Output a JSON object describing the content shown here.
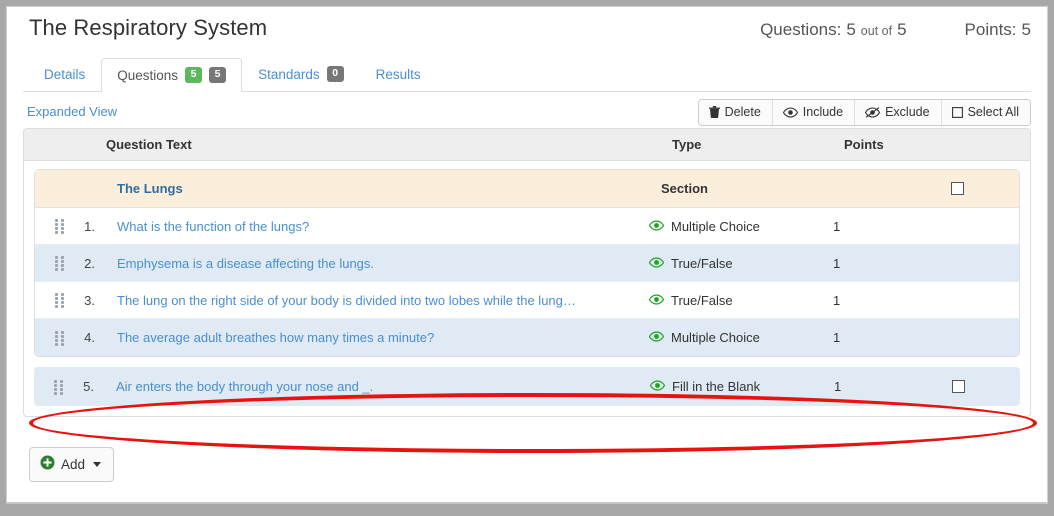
{
  "header": {
    "title": "The Respiratory System",
    "stats": [
      {
        "label": "Questions:",
        "value": "5",
        "middle": "out of",
        "total": "5"
      },
      {
        "label": "Points:",
        "value": "5",
        "middle": "",
        "total": ""
      }
    ]
  },
  "tabs": [
    {
      "label": "Details",
      "badges": [],
      "active": false
    },
    {
      "label": "Questions",
      "badges": [
        {
          "text": "5",
          "color": "green"
        },
        {
          "text": "5",
          "color": "gray"
        }
      ],
      "active": true
    },
    {
      "label": "Standards",
      "badges": [
        {
          "text": "0",
          "color": "gray"
        }
      ],
      "active": false
    },
    {
      "label": "Results",
      "badges": [],
      "active": false
    }
  ],
  "subbar": {
    "expanded_view_label": "Expanded View",
    "buttons": [
      {
        "label": "Delete",
        "icon": "trash-icon"
      },
      {
        "label": "Include",
        "icon": "eye-icon"
      },
      {
        "label": "Exclude",
        "icon": "eye-slash-icon"
      },
      {
        "label": "Select All",
        "icon": "checkbox-icon"
      }
    ]
  },
  "table": {
    "columns": {
      "question_text": "Question Text",
      "type": "Type",
      "points": "Points"
    },
    "section": {
      "title": "The Lungs",
      "type_label": "Section",
      "checkbox_checked": false
    },
    "rows": [
      {
        "number": "1.",
        "text": "What is the function of the lungs?",
        "type": "Multiple Choice",
        "points": "1",
        "visibility_icon": "eye-icon",
        "has_checkbox": false,
        "alt": false
      },
      {
        "number": "2.",
        "text": "Emphysema is a disease affecting the lungs.",
        "type": "True/False",
        "points": "1",
        "visibility_icon": "eye-icon",
        "has_checkbox": false,
        "alt": true
      },
      {
        "number": "3.",
        "text": "The lung on the right side of your body is divided into two lobes while the lung…",
        "type": "True/False",
        "points": "1",
        "visibility_icon": "eye-icon",
        "has_checkbox": false,
        "alt": false
      },
      {
        "number": "4.",
        "text": "The average adult breathes how many times a minute?",
        "type": "Multiple Choice",
        "points": "1",
        "visibility_icon": "eye-icon",
        "has_checkbox": false,
        "alt": true
      }
    ],
    "standalone_row": {
      "number": "5.",
      "text": "Air enters the body through your nose and _.",
      "type": "Fill in the Blank",
      "points": "1",
      "visibility_icon": "eye-icon",
      "has_checkbox": true,
      "checkbox_checked": false
    }
  },
  "footer": {
    "add_label": "Add"
  },
  "annotation": {
    "shape": "ellipse",
    "color": "#e8120e",
    "target": "standalone-row"
  },
  "colors": {
    "accent_link": "#4a8fd1",
    "badge_green": "#5cb85c",
    "badge_gray": "#777777",
    "section_bg": "#fbefdc",
    "row_alt_bg": "#dfeaf4",
    "eye_green": "#1aa81a",
    "add_green": "#2f7d32",
    "annotation_red": "#e8120e"
  }
}
